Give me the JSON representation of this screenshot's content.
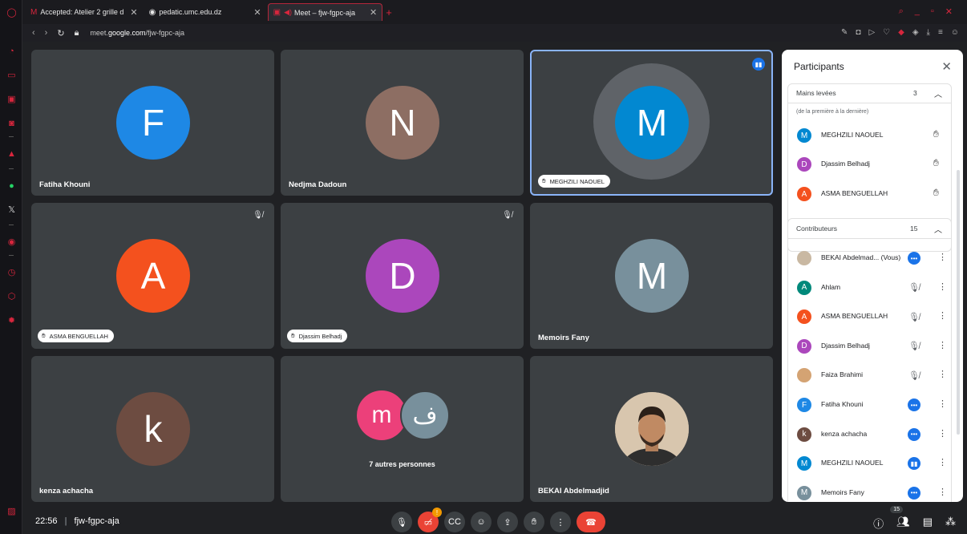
{
  "browser": {
    "tabs": [
      {
        "icon": "M",
        "title": "Accepted: Atelier 2 grille d"
      },
      {
        "icon": "◉",
        "title": "pedatic.umc.edu.dz"
      },
      {
        "icon": "▣",
        "title": "Meet – fjw-fgpc-aja"
      }
    ],
    "url_prefix": "meet.",
    "url_domain": "google.com",
    "url_path": "/fjw-fgpc-aja"
  },
  "tiles": [
    {
      "name": "Fatiha Khouni",
      "initial": "F",
      "color": "#1e88e5"
    },
    {
      "name": "Nedjma Dadoun",
      "initial": "N",
      "color": "#8d6e63"
    },
    {
      "name": "MEGHZILI NAOUEL",
      "initial": "M",
      "color": "#0288d1"
    },
    {
      "name": "ASMA BENGUELLAH",
      "initial": "A",
      "color": "#f4511e"
    },
    {
      "name": "Djassim Belhadj",
      "initial": "D",
      "color": "#ab47bc"
    },
    {
      "name": "Memoirs Fany",
      "initial": "M",
      "color": "#78909c"
    },
    {
      "name": "kenza achacha",
      "initial": "k",
      "color": "#6d4c41"
    },
    {
      "name": "7 autres personnes",
      "initial": "m",
      "initial2": "ف",
      "color": "#ec407a",
      "color2": "#78909c"
    },
    {
      "name": "BEKAI Abdelmadjid"
    }
  ],
  "panel": {
    "title": "Participants",
    "raised": {
      "title": "Mains levées",
      "count": "3",
      "note": "(de la première à la dernière)",
      "people": [
        {
          "name": "MEGHZILI NAOUEL",
          "initial": "M",
          "color": "#0288d1"
        },
        {
          "name": "Djassim Belhadj",
          "initial": "D",
          "color": "#ab47bc"
        },
        {
          "name": "ASMA BENGUELLAH",
          "initial": "A",
          "color": "#f4511e"
        }
      ]
    },
    "contributors": {
      "title": "Contributeurs",
      "count": "15",
      "people": [
        {
          "name": "BEKAI Abdelmad... (Vous)",
          "initial": "",
          "color": "#c9b8a2",
          "status": "more"
        },
        {
          "name": "Ahlam",
          "initial": "A",
          "color": "#00897b",
          "status": "mute"
        },
        {
          "name": "ASMA BENGUELLAH",
          "initial": "A",
          "color": "#f4511e",
          "status": "mute"
        },
        {
          "name": "Djassim Belhadj",
          "initial": "D",
          "color": "#ab47bc",
          "status": "mute"
        },
        {
          "name": "Faiza Brahimi",
          "initial": "",
          "color": "#d4a373",
          "status": "mute"
        },
        {
          "name": "Fatiha Khouni",
          "initial": "F",
          "color": "#1e88e5",
          "status": "more"
        },
        {
          "name": "kenza achacha",
          "initial": "k",
          "color": "#6d4c41",
          "status": "more"
        },
        {
          "name": "MEGHZILI NAOUEL",
          "initial": "M",
          "color": "#0288d1",
          "status": "speak"
        },
        {
          "name": "Memoirs Fany",
          "initial": "M",
          "color": "#78909c",
          "status": "more"
        }
      ]
    }
  },
  "bottom": {
    "time": "22:56",
    "meeting_code": "fjw-fgpc-aja",
    "participant_count": "15",
    "camera_alert": "!"
  }
}
